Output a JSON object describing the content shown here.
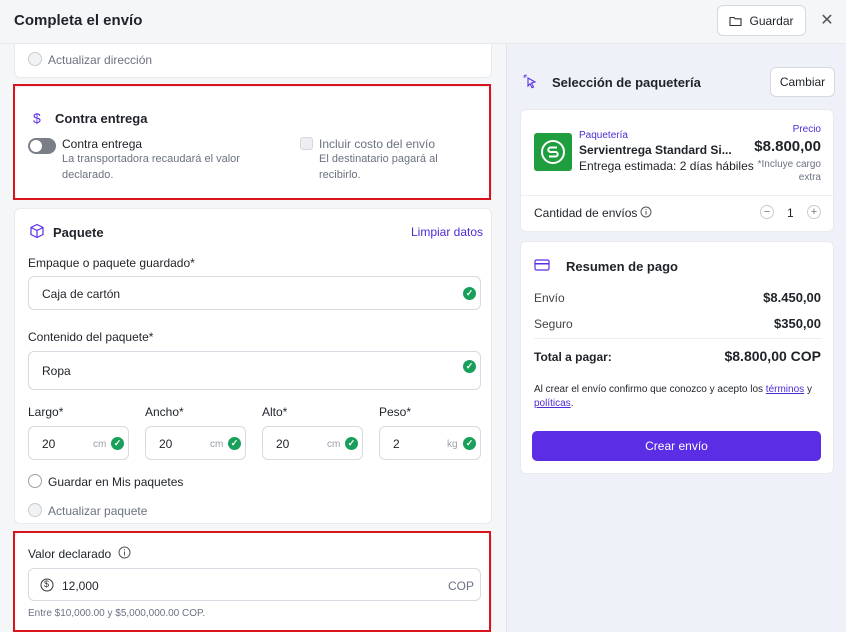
{
  "header": {
    "title": "Completa el envío",
    "save_label": "Guardar",
    "close_symbol": "✕"
  },
  "address": {
    "update_label": "Actualizar dirección"
  },
  "cod": {
    "title": "Contra entrega",
    "toggle_label": "Contra entrega",
    "toggle_desc": "La transportadora recaudará el valor declarado.",
    "include_label": "Incluir costo del envío",
    "include_desc": "El destinatario pagará al recibirlo."
  },
  "package": {
    "title": "Paquete",
    "clear_label": "Limpiar datos",
    "packaging_label": "Empaque o paquete guardado*",
    "packaging_value": "Caja de cartón",
    "contents_label": "Contenido del paquete*",
    "contents_value": "Ropa",
    "dims": [
      {
        "label": "Largo*",
        "value": "20",
        "unit": "cm"
      },
      {
        "label": "Ancho*",
        "value": "20",
        "unit": "cm"
      },
      {
        "label": "Alto*",
        "value": "20",
        "unit": "cm"
      },
      {
        "label": "Peso*",
        "value": "2",
        "unit": "kg"
      }
    ],
    "save_mine_label": "Guardar en Mis paquetes",
    "update_label": "Actualizar paquete"
  },
  "declared": {
    "title": "Valor declarado",
    "currency_symbol": "$",
    "value": "12,000",
    "currency": "COP",
    "hint": "Entre $10,000.00 y $5,000,000.00 COP."
  },
  "carrier": {
    "section_title": "Selección de paquetería",
    "change_label": "Cambiar",
    "tag": "Paquetería",
    "name": "Servientrega Standard Si...",
    "estimate": "Entrega estimada: 2 días hábiles",
    "price_label": "Precio",
    "price": "$8.800,00",
    "price_note": "*Incluye cargo extra",
    "qty_label": "Cantidad de envíos",
    "qty": "1",
    "minus": "−",
    "plus": "+"
  },
  "summary": {
    "title": "Resumen de pago",
    "rows": [
      {
        "label": "Envío",
        "value": "$8.450,00"
      },
      {
        "label": "Seguro",
        "value": "$350,00"
      }
    ],
    "total_label": "Total a pagar:",
    "total_value": "$8.800,00 COP",
    "terms_pre": "Al crear el envío confirmo que conozco y acepto los",
    "terms_link1": "términos",
    "terms_and": "y",
    "terms_link2": "políticas",
    "terms_end": ".",
    "create_label": "Crear envío"
  },
  "colors": {
    "accent": "#5b2ee6",
    "success": "#18a05b",
    "highlight": "#d9141c",
    "carrier_logo": "#1e9e3f"
  }
}
